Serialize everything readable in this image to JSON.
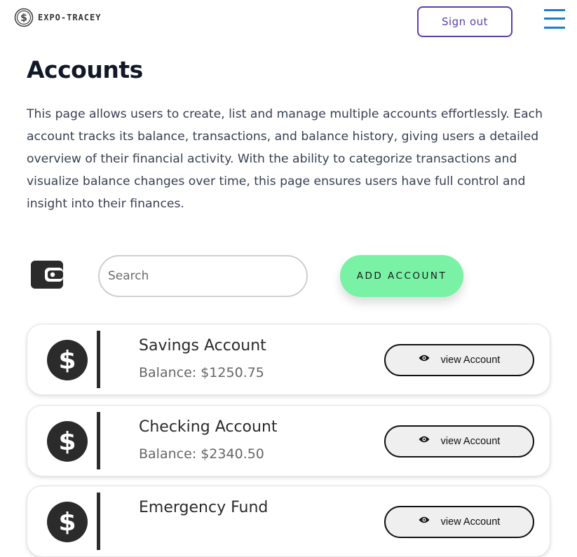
{
  "header": {
    "brand": "EXPO-TRACEY",
    "signout_label": "Sign out"
  },
  "page": {
    "title": "Accounts",
    "intro": "This page allows users to create, list and manage multiple accounts effortlessly. Each account tracks its balance, transactions, and balance history, giving users a detailed overview of their financial activity. With the ability to categorize transactions and visualize balance changes over time, this page ensures users have full control and insight into their finances."
  },
  "toolbar": {
    "search_placeholder": "Search",
    "add_label": "ADD ACCOUNT"
  },
  "accounts": [
    {
      "name": "Savings Account",
      "balance": "Balance: $1250.75",
      "view_label": "view Account"
    },
    {
      "name": "Checking Account",
      "balance": "Balance: $2340.50",
      "view_label": "view Account"
    },
    {
      "name": "Emergency Fund",
      "balance": "",
      "view_label": "view Account"
    }
  ],
  "icons": {
    "logo": "dollar-coin-icon",
    "menu": "hamburger-menu-icon",
    "wallet": "wallet-icon",
    "account": "dollar-circle-icon",
    "view": "eye-icon"
  },
  "colors": {
    "accent_purple": "#5b3fb0",
    "menu_blue": "#1e7fc7",
    "add_green": "#79f2a5",
    "icon_dark": "#2b2b2b"
  }
}
